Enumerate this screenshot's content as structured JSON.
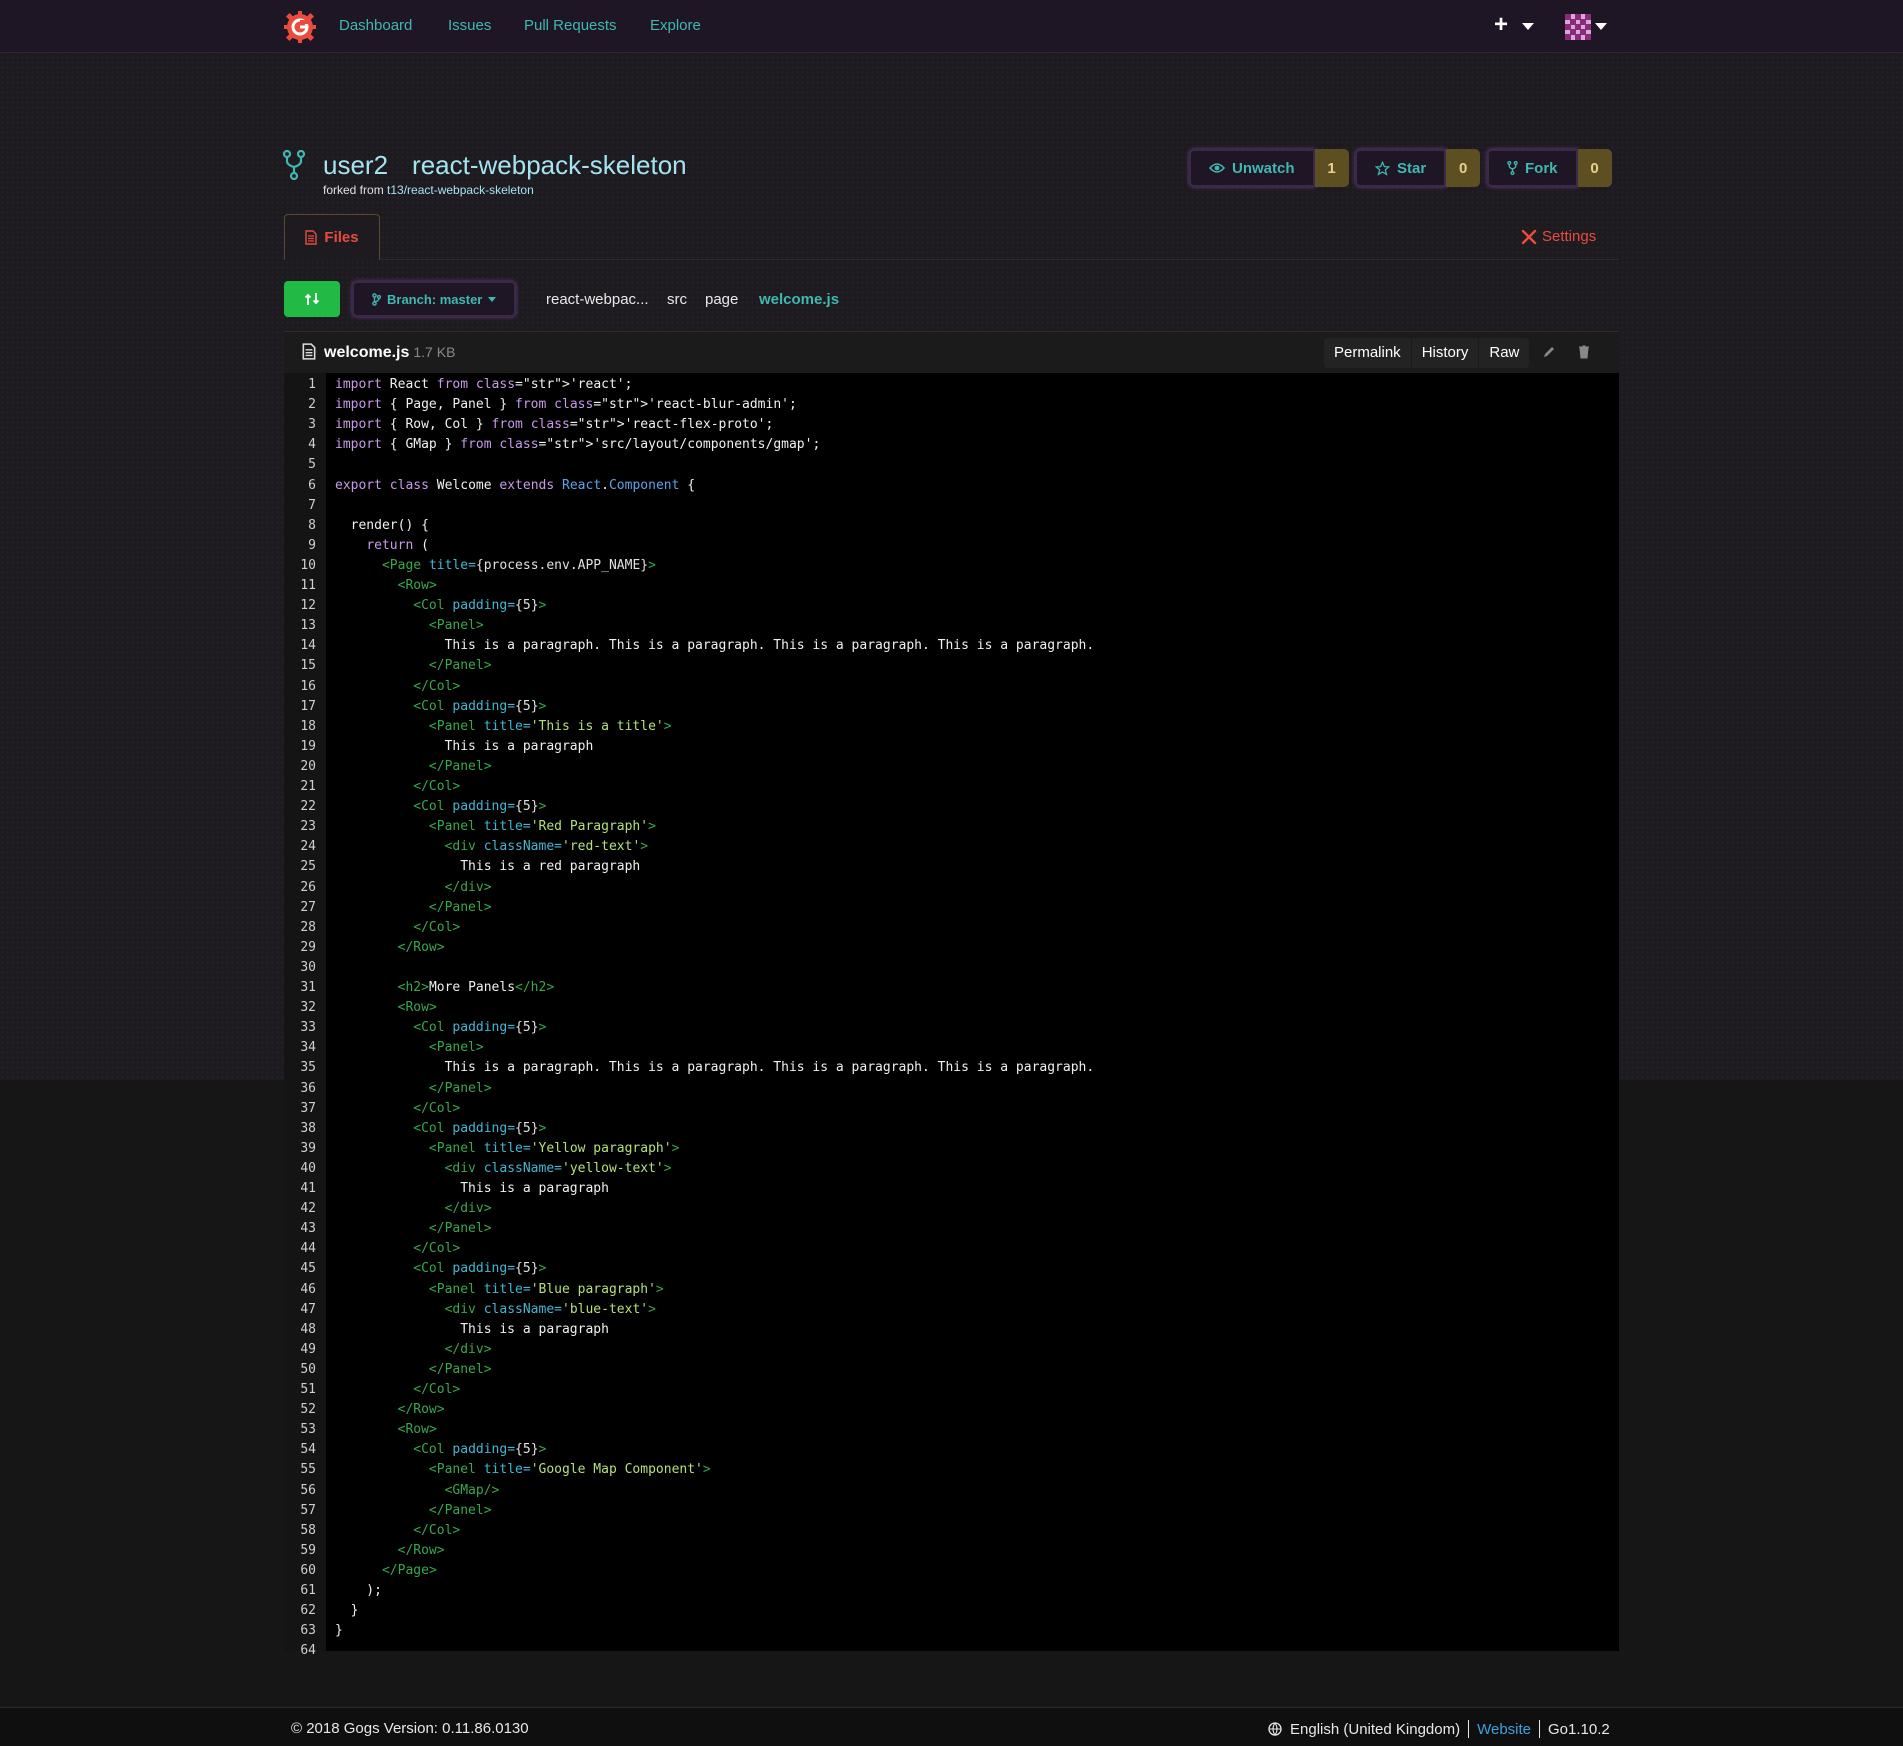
{
  "nav": {
    "items": [
      "Dashboard",
      "Issues",
      "Pull Requests",
      "Explore"
    ],
    "plus": "+"
  },
  "repo": {
    "owner": "user2",
    "name": "react-webpack-skeleton",
    "forked_label": "forked from ",
    "forked_source": "t13/react-webpack-skeleton",
    "unwatch_label": "Unwatch",
    "unwatch_count": "1",
    "star_label": "Star",
    "star_count": "0",
    "fork_label": "Fork",
    "fork_count": "0"
  },
  "tabs": {
    "files": "Files",
    "settings": "Settings"
  },
  "branch": {
    "label": "Branch: master",
    "crumbs": [
      "react-webpac...",
      "src",
      "page",
      "welcome.js"
    ]
  },
  "file": {
    "name": "welcome.js",
    "size": "1.7 KB",
    "actions": [
      "Permalink",
      "History",
      "Raw"
    ]
  },
  "code_lines": [
    "import React from 'react';",
    "import { Page, Panel } from 'react-blur-admin';",
    "import { Row, Col } from 'react-flex-proto';",
    "import { GMap } from 'src/layout/components/gmap';",
    "",
    "export class Welcome extends React.Component {",
    "",
    "  render() {",
    "    return (",
    "      <Page title={process.env.APP_NAME}>",
    "        <Row>",
    "          <Col padding={5}>",
    "            <Panel>",
    "              This is a paragraph. This is a paragraph. This is a paragraph. This is a paragraph.",
    "            </Panel>",
    "          </Col>",
    "          <Col padding={5}>",
    "            <Panel title='This is a title'>",
    "              This is a paragraph",
    "            </Panel>",
    "          </Col>",
    "          <Col padding={5}>",
    "            <Panel title='Red Paragraph'>",
    "              <div className='red-text'>",
    "                This is a red paragraph",
    "              </div>",
    "            </Panel>",
    "          </Col>",
    "        </Row>",
    "",
    "        <h2>More Panels</h2>",
    "        <Row>",
    "          <Col padding={5}>",
    "            <Panel>",
    "              This is a paragraph. This is a paragraph. This is a paragraph. This is a paragraph.",
    "            </Panel>",
    "          </Col>",
    "          <Col padding={5}>",
    "            <Panel title='Yellow paragraph'>",
    "              <div className='yellow-text'>",
    "                This is a paragraph",
    "              </div>",
    "            </Panel>",
    "          </Col>",
    "          <Col padding={5}>",
    "            <Panel title='Blue paragraph'>",
    "              <div className='blue-text'>",
    "                This is a paragraph",
    "              </div>",
    "            </Panel>",
    "          </Col>",
    "        </Row>",
    "        <Row>",
    "          <Col padding={5}>",
    "            <Panel title='Google Map Component'>",
    "              <GMap/>",
    "            </Panel>",
    "          </Col>",
    "        </Row>",
    "      </Page>",
    "    );",
    "  }",
    "}",
    ""
  ],
  "footer": {
    "left": "© 2018 Gogs Version: 0.11.86.0130",
    "language": "English (United Kingdom)",
    "website": "Website",
    "go_version": "Go1.10.2"
  },
  "colors": {
    "accent": "#3fb8b0",
    "danger": "#e84c3d",
    "success": "#21ba45",
    "count_bg": "#5e4f23"
  }
}
